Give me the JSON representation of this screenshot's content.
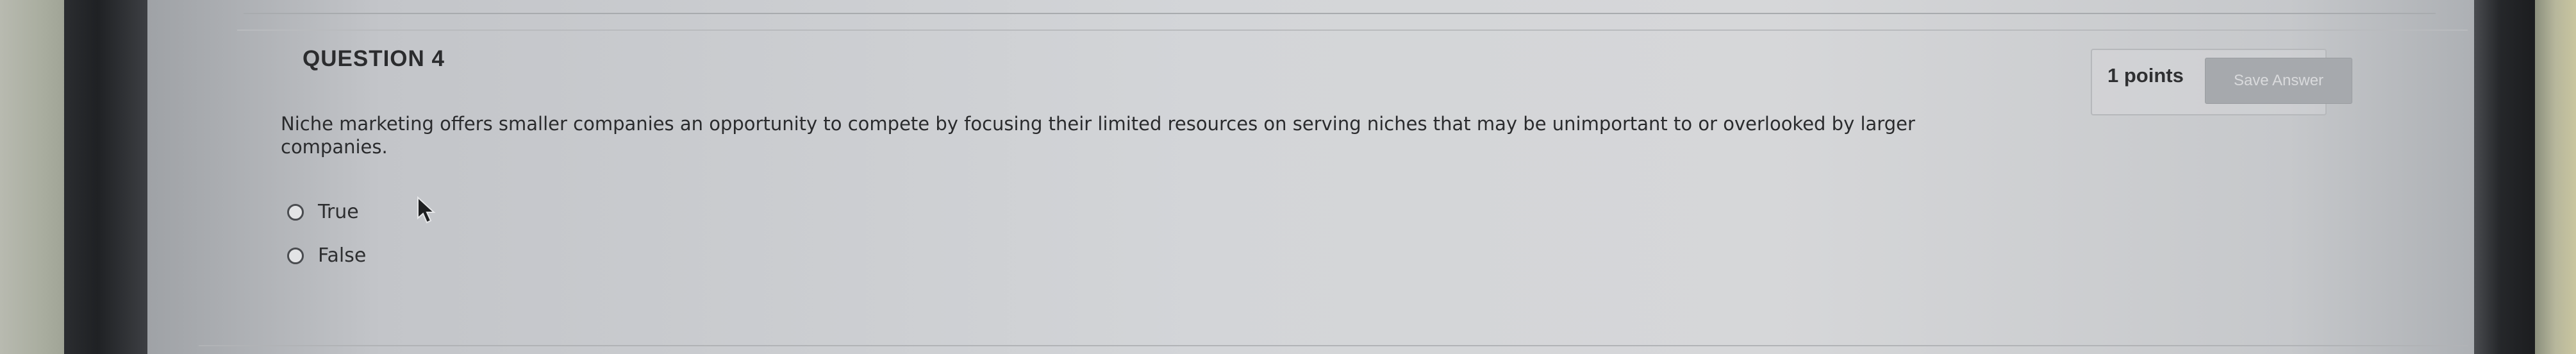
{
  "question": {
    "title": "QUESTION 4",
    "points_label": "1 points",
    "save_label": "Save Answer",
    "text": "Niche marketing offers smaller companies an opportunity to compete by focusing their limited resources on serving niches that may be unimportant to or overlooked by larger companies.",
    "options": [
      {
        "label": "True",
        "selected": false
      },
      {
        "label": "False",
        "selected": false
      }
    ]
  },
  "colors": {
    "screen_background": "#d4d5d8",
    "text": "#2a2b2d",
    "save_button_background": "#a6a9ad",
    "save_button_text": "#d9dadc"
  }
}
